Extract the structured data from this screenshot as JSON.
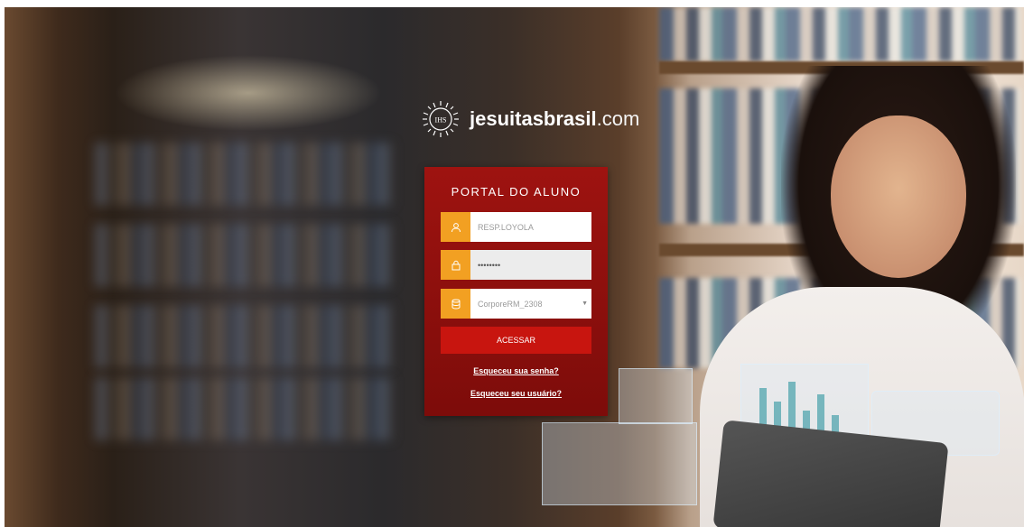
{
  "brand": {
    "name_bold": "jesuitasbrasil",
    "name_suffix": ".com",
    "seal_text": "IHS"
  },
  "login": {
    "title": "PORTAL DO ALUNO",
    "username_value": "RESP.LOYOLA",
    "password_value": "••••••••",
    "database_value": "CorporeRM_2308",
    "submit_label": "ACESSAR",
    "forgot_password": "Esqueceu sua senha?",
    "forgot_user": "Esqueceu seu usuário?"
  },
  "icons": {
    "username": "user-icon",
    "password": "lock-icon",
    "database": "database-icon",
    "select": "caret-down-icon"
  },
  "colors": {
    "panel": "#9e1310",
    "panel_dark": "#7d0c0a",
    "icon_accent": "#f2a022",
    "button": "#c8150f"
  }
}
